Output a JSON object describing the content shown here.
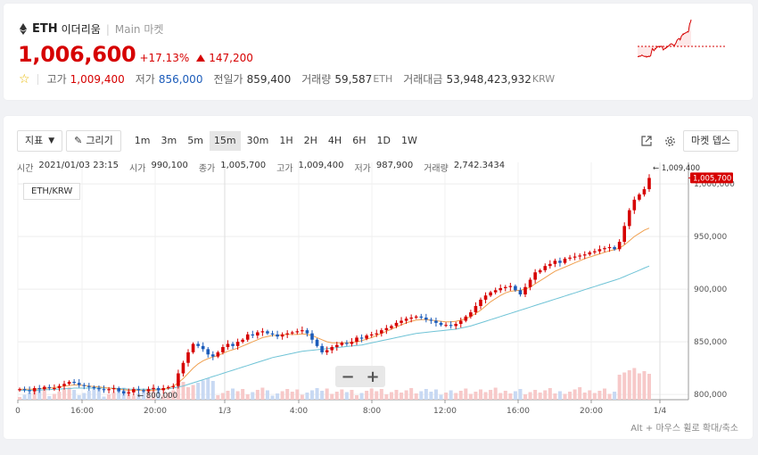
{
  "header": {
    "symbol": "ETH",
    "korean_name": "이더리움",
    "market": "Main 마켓",
    "price": "1,006,600",
    "change_pct": "+17.13%",
    "change_abs": "147,200",
    "high_label": "고가",
    "high": "1,009,400",
    "low_label": "저가",
    "low": "856,000",
    "prev_label": "전일가",
    "prev": "859,400",
    "volume_label": "거래량",
    "volume": "59,587",
    "volume_unit": "ETH",
    "amount_label": "거래대금",
    "amount": "53,948,423,932",
    "amount_unit": "KRW"
  },
  "toolbar": {
    "indicator_label": "지표",
    "draw_label": "그리기",
    "timeframes": [
      "1m",
      "3m",
      "5m",
      "15m",
      "30m",
      "1H",
      "2H",
      "4H",
      "6H",
      "1D",
      "1W"
    ],
    "selected_timeframe": "15m",
    "market_depth_label": "마켓 뎁스"
  },
  "info": {
    "time_label": "시간",
    "time": "2021/01/03 23:15",
    "open_label": "시가",
    "open": "990,100",
    "close_label": "종가",
    "close": "1,005,700",
    "high_label": "고가",
    "high": "1,009,400",
    "low_label": "저가",
    "low": "987,900",
    "volume_label": "거래량",
    "volume": "2,742.3434"
  },
  "chart_data": {
    "type": "candlestick",
    "pair": "ETH/KRW",
    "x_ticks": [
      "0",
      "16:00",
      "20:00",
      "1/3",
      "4:00",
      "8:00",
      "12:00",
      "16:00",
      "20:00",
      "1/4"
    ],
    "y_ticks": [
      "800,000",
      "850,000",
      "900,000",
      "950,000",
      "1,000,000"
    ],
    "ylim": [
      795000,
      1012000
    ],
    "high_marker": "1,009,400",
    "low_marker": "800,000",
    "last_price_tag": "1,005,700",
    "close_series": [
      805000,
      804000,
      803000,
      806000,
      805000,
      807000,
      806000,
      806000,
      808000,
      810000,
      812000,
      811000,
      809000,
      808000,
      807000,
      806000,
      805000,
      804000,
      805000,
      806000,
      803000,
      801000,
      802000,
      805000,
      804000,
      803000,
      805000,
      806000,
      804000,
      806000,
      807000,
      808000,
      820000,
      830000,
      840000,
      848000,
      846000,
      843000,
      838000,
      836000,
      840000,
      845000,
      848000,
      846000,
      850000,
      852000,
      857000,
      856000,
      859000,
      860000,
      858000,
      857000,
      855000,
      857000,
      858000,
      859000,
      860000,
      861000,
      858000,
      852000,
      846000,
      840000,
      842000,
      845000,
      847000,
      849000,
      848000,
      850000,
      854000,
      853000,
      856000,
      857000,
      858000,
      861000,
      863000,
      865000,
      868000,
      870000,
      872000,
      873000,
      874000,
      873000,
      871000,
      870000,
      868000,
      866000,
      866000,
      865000,
      867000,
      870000,
      874000,
      878000,
      884000,
      890000,
      894000,
      897000,
      899000,
      901000,
      902000,
      903000,
      899000,
      895000,
      902000,
      909000,
      916000,
      918000,
      922000,
      924000,
      927000,
      925000,
      929000,
      930000,
      931000,
      932000,
      933000,
      935000,
      936000,
      938000,
      939000,
      940000,
      938000,
      945000,
      960000,
      975000,
      985000,
      990000,
      995000,
      1005700
    ],
    "ma_fast": [
      805000,
      805000,
      805000,
      805000,
      805500,
      806000,
      806000,
      806500,
      807000,
      808000,
      808500,
      809000,
      809000,
      808500,
      808000,
      807500,
      807000,
      806500,
      806000,
      805500,
      805000,
      804500,
      804000,
      804000,
      804000,
      804000,
      804000,
      804000,
      804500,
      805000,
      806000,
      808000,
      811000,
      815000,
      820000,
      825000,
      829000,
      832000,
      834000,
      835500,
      837000,
      839000,
      841000,
      842500,
      844000,
      846000,
      848000,
      850000,
      852000,
      854000,
      855000,
      856000,
      856000,
      856500,
      857000,
      857000,
      857000,
      857500,
      857000,
      856000,
      854000,
      852000,
      850000,
      849000,
      849000,
      849000,
      849000,
      849500,
      850000,
      851000,
      852500,
      854000,
      856000,
      858000,
      860000,
      862000,
      864000,
      866000,
      868000,
      869500,
      870500,
      871000,
      871000,
      870500,
      870000,
      869500,
      869000,
      869000,
      869500,
      870500,
      872000,
      874000,
      877000,
      880000,
      884000,
      888000,
      891000,
      894000,
      896500,
      898000,
      898500,
      899000,
      900000,
      902000,
      905000,
      908000,
      911000,
      914000,
      917000,
      919000,
      921000,
      923000,
      925000,
      927000,
      929000,
      930500,
      932000,
      933500,
      935000,
      936500,
      937500,
      939000,
      942000,
      946000,
      950000,
      953000,
      956000,
      958000
    ],
    "ma_slow": [
      804000,
      804000,
      804000,
      804000,
      804000,
      804500,
      804500,
      805000,
      805000,
      805500,
      805500,
      806000,
      806000,
      806000,
      806000,
      806000,
      806000,
      806000,
      806000,
      806000,
      805500,
      805500,
      805000,
      805000,
      805000,
      805000,
      805000,
      805000,
      805000,
      805000,
      805500,
      806000,
      807000,
      808000,
      809500,
      811000,
      812500,
      814000,
      815500,
      817000,
      818500,
      820000,
      821500,
      823000,
      824500,
      826000,
      827500,
      829000,
      830500,
      832000,
      833500,
      835000,
      836000,
      837000,
      838000,
      839000,
      840000,
      841000,
      841500,
      842000,
      842500,
      843000,
      843500,
      844000,
      844500,
      845000,
      845500,
      846000,
      846500,
      847000,
      848000,
      849000,
      850000,
      851000,
      852000,
      853000,
      854000,
      855000,
      856000,
      857000,
      858000,
      858500,
      859000,
      859500,
      860000,
      860500,
      861000,
      861500,
      862000,
      863000,
      864000,
      865000,
      866500,
      868000,
      869500,
      871000,
      872500,
      874000,
      875500,
      877000,
      878500,
      880000,
      881500,
      883000,
      884500,
      886000,
      887500,
      889000,
      890500,
      892000,
      893500,
      895000,
      896500,
      898000,
      899500,
      901000,
      902500,
      904000,
      905500,
      907000,
      908500,
      910000,
      912000,
      914000,
      916000,
      918000,
      920000,
      922000
    ]
  }
}
